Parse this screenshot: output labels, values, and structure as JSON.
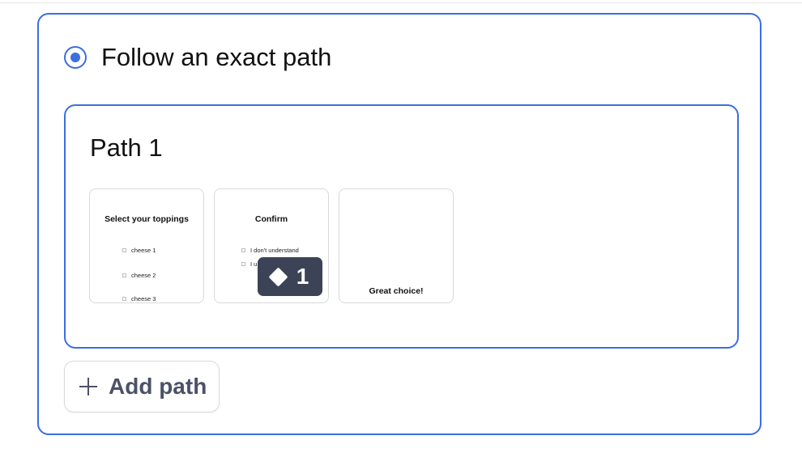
{
  "option": {
    "label": "Follow an exact path",
    "selected": true
  },
  "path": {
    "title": "Path 1",
    "screens": [
      {
        "title": "Select your toppings",
        "options": [
          "cheese 1",
          "cheese 2",
          "cheese 3"
        ]
      },
      {
        "title": "Confirm",
        "options": [
          "I don't understand",
          "I u"
        ]
      },
      {
        "title": "Great choice!",
        "options": []
      }
    ],
    "badge": {
      "icon": "diamond-icon",
      "count": "1"
    }
  },
  "add_path": {
    "icon": "plus-icon",
    "label": "Add path"
  },
  "colors": {
    "accent": "#3b6ee0",
    "badge_bg": "#3d4356",
    "button_text": "#4b5268"
  }
}
